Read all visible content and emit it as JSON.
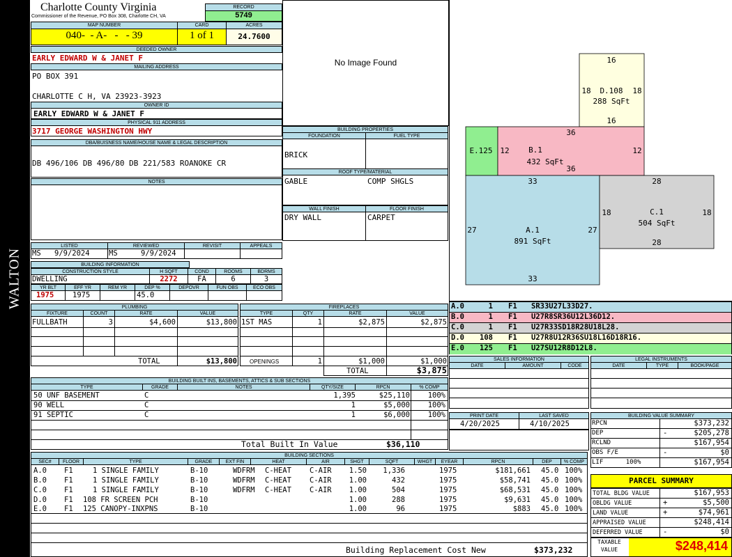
{
  "sidebar": {
    "label": "WALTON"
  },
  "header": {
    "county": "Charlotte County Virginia",
    "subtitle": "Commissioner of the Revenue, PO Box 308, Charlotte CH, VA",
    "record_label": "RECORD",
    "record": "5749",
    "map_label": "MAP NUMBER",
    "map_number": "040-  - A-   -   - 39",
    "card_label": "CARD",
    "card": "1 of 1",
    "acres_label": "ACRES",
    "acres": "24.7600"
  },
  "owner": {
    "deeded_label": "DEEDED OWNER",
    "deeded": "EARLY EDWARD W & JANET F",
    "mailing_label": "MAILING ADDRESS",
    "mail1": "PO BOX 391",
    "mail2": "CHARLOTTE C H, VA 23923-3923",
    "owner_id_label": "OWNER ID",
    "owner_id": "EARLY EDWARD W & JANET F",
    "address_label": "PHYSICAL 911 ADDRESS",
    "address": "3717 GEORGE WASHINGTON HWY",
    "legal_label": "DBA/BUISNESS NAME/HOUSE NAME & LEGAL DESCRIPTION",
    "legal": "DB 496/106 DB 496/80 DB 221/583 ROANOKE CR",
    "notes_label": "NOTES"
  },
  "photo": {
    "text": "No Image Found"
  },
  "props": {
    "title": "BUILDING PROPERTIES",
    "foundation_label": "FOUNDATION",
    "fuel_label": "FUEL TYPE",
    "foundation": "BRICK",
    "roof_label": "ROOF TYPE/MATERIAL",
    "roof": "GABLE",
    "roof_mat": "COMP SHGLS",
    "wall_label": "WALL FINISH",
    "floor_label": "FLOOR FINISH",
    "wall": "DRY WALL",
    "floor": "CARPET"
  },
  "review": {
    "listed_label": "LISTED",
    "reviewed_label": "REVIEWED",
    "revisit_label": "REVISIT",
    "appeals_label": "APPEALS",
    "listed_by": "MS",
    "listed_date": "9/9/2024",
    "reviewed_by": "MS",
    "reviewed_date": "9/9/2024"
  },
  "binfo": {
    "title": "BUILDING INFORMATION",
    "cs_label": "CONSTRUCTION STYLE",
    "hsqft_label": "H SQFT",
    "cond_label": "COND",
    "rooms_label": "ROOMS",
    "bdrms_label": "BDRMS",
    "style": "DWELLING",
    "hsqft": "2272",
    "cond": "FA",
    "rooms": "6",
    "bdrms": "3",
    "yrblt_label": "YR BLT",
    "effyr_label": "EFF YR",
    "remyr_label": "REM YR",
    "dep_label": "DEP %",
    "depovr_label": "DEPOVR",
    "funobs_label": "FUN OBS",
    "ecoobs_label": "ECO OBS",
    "yrblt": "1975",
    "effyr": "1975",
    "dep": "45.0"
  },
  "plumbing": {
    "title": "PLUMBING",
    "cols": [
      "FIXTURE",
      "COUNT",
      "RATE",
      "VALUE"
    ],
    "rows": [
      [
        "FULLBATH",
        "3",
        "$4,600",
        "$13,800"
      ]
    ],
    "total_label": "TOTAL",
    "total": "$13,800"
  },
  "fireplaces": {
    "title": "FIREPLACES",
    "cols": [
      "TYPE",
      "QTY",
      "RATE",
      "VALUE"
    ],
    "rows": [
      [
        "1ST MAS",
        "1",
        "$2,875",
        "$2,875"
      ]
    ],
    "openings_label": "OPENINGS",
    "openings": [
      "1",
      "$1,000",
      "$1,000"
    ],
    "total_label": "TOTAL",
    "total": "$3,875"
  },
  "builtins": {
    "title": "BUILDING BUILT INS, BASEMENTS, ATTICS & SUB SECTIONS",
    "cols": [
      "TYPE",
      "GRADE",
      "NOTES",
      "QTY/SIZE",
      "RPCN",
      "% COMP"
    ],
    "rows": [
      [
        "50 UNF BASEMENT",
        "C",
        "",
        "1,395",
        "$25,110",
        "100%"
      ],
      [
        "90 WELL",
        "C",
        "",
        "1",
        "$5,000",
        "100%"
      ],
      [
        "91 SEPTIC",
        "C",
        "",
        "1",
        "$6,000",
        "100%"
      ]
    ],
    "total_label": "Total Built In Value",
    "total": "$36,110"
  },
  "sections": {
    "title": "BUILDING SECTIONS",
    "cols": [
      "SEC#",
      "FLOOR",
      "TYPE",
      "GRADE",
      "EXT FIN",
      "HEAT",
      "AIR",
      "SHGT",
      "SQFT",
      "WHGT",
      "EYEAR",
      "RPCN",
      "DEP",
      "% COMP"
    ],
    "rows": [
      [
        "A.0",
        "F1",
        "1 SINGLE FAMILY",
        "B-10",
        "WDFRM",
        "C-HEAT",
        "C-AIR",
        "1.50",
        "1,336",
        "",
        "1975",
        "$181,661",
        "45.0",
        "100%"
      ],
      [
        "B.0",
        "F1",
        "1 SINGLE FAMILY",
        "B-10",
        "WDFRM",
        "C-HEAT",
        "C-AIR",
        "1.00",
        "432",
        "",
        "1975",
        "$58,741",
        "45.0",
        "100%"
      ],
      [
        "C.0",
        "F1",
        "1 SINGLE FAMILY",
        "B-10",
        "WDFRM",
        "C-HEAT",
        "C-AIR",
        "1.00",
        "504",
        "",
        "1975",
        "$68,531",
        "45.0",
        "100%"
      ],
      [
        "D.0",
        "F1",
        "108 FR SCREEN PCH",
        "B-10",
        "",
        "",
        "",
        "1.00",
        "288",
        "",
        "1975",
        "$9,631",
        "45.0",
        "100%"
      ],
      [
        "E.0",
        "F1",
        "125 CANOPY-INXPNS",
        "B-10",
        "",
        "",
        "",
        "1.00",
        "96",
        "",
        "1975",
        "$883",
        "45.0",
        "100%"
      ]
    ],
    "rcn_label": "Building Replacement Cost New",
    "rcn": "$373,232"
  },
  "sketch": {
    "areas": [
      {
        "id": "D.108",
        "sqft": "288 SqFt",
        "top": "16",
        "bottom": "16",
        "left": "18",
        "right": "18"
      },
      {
        "id": "E.125"
      },
      {
        "id": "B.1",
        "sqft": "432 SqFt",
        "top": "36",
        "bottom": "36",
        "left": "12",
        "right": "12"
      },
      {
        "id": "A.1",
        "sqft": "891 SqFt",
        "top": "33",
        "bottom": "33",
        "left": "27",
        "right": "27"
      },
      {
        "id": "C.1",
        "sqft": "504 SqFt",
        "top": "28",
        "bottom": "28",
        "left": "18",
        "right": "18"
      }
    ]
  },
  "legend": [
    {
      "sec": "A.0",
      "count": "1",
      "floor": "F1",
      "code": "SR33U27L33D27.",
      "color": "#b7dde8"
    },
    {
      "sec": "B.0",
      "count": "1",
      "floor": "F1",
      "code": "U27R8SR36U12L36D12.",
      "color": "#f8b8c4"
    },
    {
      "sec": "C.0",
      "count": "1",
      "floor": "F1",
      "code": "U27R33SD18R28U18L28.",
      "color": "#d3d3d3"
    },
    {
      "sec": "D.0",
      "count": "108",
      "floor": "F1",
      "code": "U27R8U12R36SU18L16D18R16.",
      "color": "#ffffe0"
    },
    {
      "sec": "E.0",
      "count": "125",
      "floor": "F1",
      "code": "U27SU12R8D12L8.",
      "color": "#90ee90"
    }
  ],
  "sales": {
    "title": "SALES INFORMATION",
    "cols": [
      "DATE",
      "AMOUNT",
      "CODE"
    ]
  },
  "legal_inst": {
    "title": "LEGAL INSTRUMENTS",
    "cols": [
      "DATE",
      "TYPE",
      "BOOK/PAGE"
    ]
  },
  "dates": {
    "print_label": "PRINT DATE",
    "print": "4/20/2025",
    "saved_label": "LAST SAVED",
    "saved": "4/10/2025"
  },
  "bvs": {
    "title": "BUILDING VALUE SUMMARY",
    "rows": [
      [
        "RPCN",
        "",
        "$373,232"
      ],
      [
        "DEP",
        "-",
        "$205,278"
      ],
      [
        "RCLND",
        "",
        "$167,954"
      ],
      [
        "OBS F/E",
        "-",
        "$0"
      ],
      [
        "LIF      100%",
        "",
        "$167,954"
      ]
    ]
  },
  "parcel": {
    "title": "PARCEL SUMMARY",
    "rows": [
      [
        "TOTAL BLDG VALUE",
        "",
        "$167,953"
      ],
      [
        "OBLDG VALUE",
        "+",
        "$5,500"
      ],
      [
        "LAND VALUE",
        "+",
        "$74,961"
      ],
      [
        "APPRAISED VALUE",
        "",
        "$248,414"
      ],
      [
        "DEFERRED VALUE",
        "-",
        "$0"
      ]
    ],
    "taxable_label1": "TAXABLE",
    "taxable_label2": "VALUE",
    "taxable": "$248,414"
  }
}
